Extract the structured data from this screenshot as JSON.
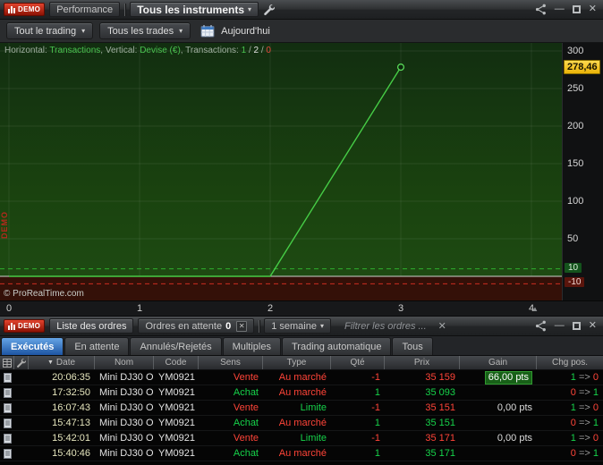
{
  "icons": {
    "caret_down": "▾",
    "sort_desc": "▼",
    "close": "✕",
    "minimize": "—",
    "scroll_up": "▲"
  },
  "colors": {
    "red": "#ff4438",
    "green": "#16d24a",
    "gray_arrow": "#9a9a9a"
  },
  "performance_window": {
    "demo_badge": "DEMO",
    "title": "Performance",
    "instruments_dropdown": "Tous les instruments",
    "trading_filter": "Tout le trading",
    "trades_filter": "Tous les trades",
    "date_label": "Aujourd'hui",
    "copyright": "© ProRealTime.com",
    "watermark": "DEMO"
  },
  "chart_data": {
    "type": "line",
    "x_axis_label": "Transactions",
    "y_axis_label": "Devise (€)",
    "legend_parts": [
      {
        "text": "Horizontal: ",
        "color": "label"
      },
      {
        "text": "Transactions",
        "color": "green"
      },
      {
        "text": ", ",
        "color": "label"
      },
      {
        "text": "Vertical: ",
        "color": "label"
      },
      {
        "text": "Devise (€)",
        "color": "green"
      },
      {
        "text": ", ",
        "color": "label"
      },
      {
        "text": "Transactions: ",
        "color": "label"
      },
      {
        "text": "1",
        "color": "green"
      },
      {
        "text": " / ",
        "color": "label"
      },
      {
        "text": "2",
        "color": "white"
      },
      {
        "text": " / ",
        "color": "label"
      },
      {
        "text": "0",
        "color": "red"
      }
    ],
    "x_ticks": [
      0,
      1,
      2,
      3,
      4
    ],
    "y_ticks": [
      300,
      250,
      200,
      150,
      100,
      50
    ],
    "ylim": [
      -32,
      310
    ],
    "zero_line": 0,
    "threshold_lines": [
      {
        "value": 10,
        "label": "10",
        "color": "green"
      },
      {
        "value": -10,
        "label": "-10",
        "color": "red"
      }
    ],
    "points": [
      {
        "x": 0,
        "y": 0
      },
      {
        "x": 1,
        "y": 0
      },
      {
        "x": 2,
        "y": 0
      },
      {
        "x": 3,
        "y": 278.46
      }
    ],
    "current_value": 278.46,
    "current_value_label": "278,46"
  },
  "orders_window": {
    "demo_badge": "DEMO",
    "list_tab": "Liste des ordres",
    "pending_tab": "Ordres en attente",
    "pending_count": "0",
    "period_dropdown": "1 semaine",
    "filter_placeholder": "Filtrer les ordres ...",
    "tabs": [
      "Exécutés",
      "En attente",
      "Annulés/Rejetés",
      "Multiples",
      "Trading automatique",
      "Tous"
    ],
    "active_tab_index": 0,
    "table": {
      "headers": {
        "date": "Date",
        "nom": "Nom",
        "code": "Code",
        "sens": "Sens",
        "type": "Type",
        "qte": "Qté",
        "prix": "Prix",
        "gain": "Gain",
        "chg": "Chg pos."
      },
      "sell_label": "Vente",
      "market_label": "Au marché",
      "chg_arrow": "=>",
      "rows": [
        {
          "date": "20:06:35",
          "nom": "Mini DJ30 O...",
          "code": "YM0921",
          "sens": "Vente",
          "type": "Au marché",
          "qte": "-1",
          "prix": "35 159",
          "gain": "66,00 pts",
          "gain_highlight": true,
          "chg_from": "1",
          "chg_to": "0"
        },
        {
          "date": "17:32:50",
          "nom": "Mini DJ30 O...",
          "code": "YM0921",
          "sens": "Achat",
          "type": "Au marché",
          "qte": "1",
          "prix": "35 093",
          "gain": "",
          "gain_highlight": false,
          "chg_from": "0",
          "chg_to": "1"
        },
        {
          "date": "16:07:43",
          "nom": "Mini DJ30 O...",
          "code": "YM0921",
          "sens": "Vente",
          "type": "Limite",
          "qte": "-1",
          "prix": "35 151",
          "gain": "0,00 pts",
          "gain_highlight": false,
          "chg_from": "1",
          "chg_to": "0"
        },
        {
          "date": "15:47:13",
          "nom": "Mini DJ30 O...",
          "code": "YM0921",
          "sens": "Achat",
          "type": "Au marché",
          "qte": "1",
          "prix": "35 151",
          "gain": "",
          "gain_highlight": false,
          "chg_from": "0",
          "chg_to": "1"
        },
        {
          "date": "15:42:01",
          "nom": "Mini DJ30 O...",
          "code": "YM0921",
          "sens": "Vente",
          "type": "Limite",
          "qte": "-1",
          "prix": "35 171",
          "gain": "0,00 pts",
          "gain_highlight": false,
          "chg_from": "1",
          "chg_to": "0"
        },
        {
          "date": "15:40:46",
          "nom": "Mini DJ30 O...",
          "code": "YM0921",
          "sens": "Achat",
          "type": "Au marché",
          "qte": "1",
          "prix": "35 171",
          "gain": "",
          "gain_highlight": false,
          "chg_from": "0",
          "chg_to": "1"
        }
      ]
    }
  }
}
